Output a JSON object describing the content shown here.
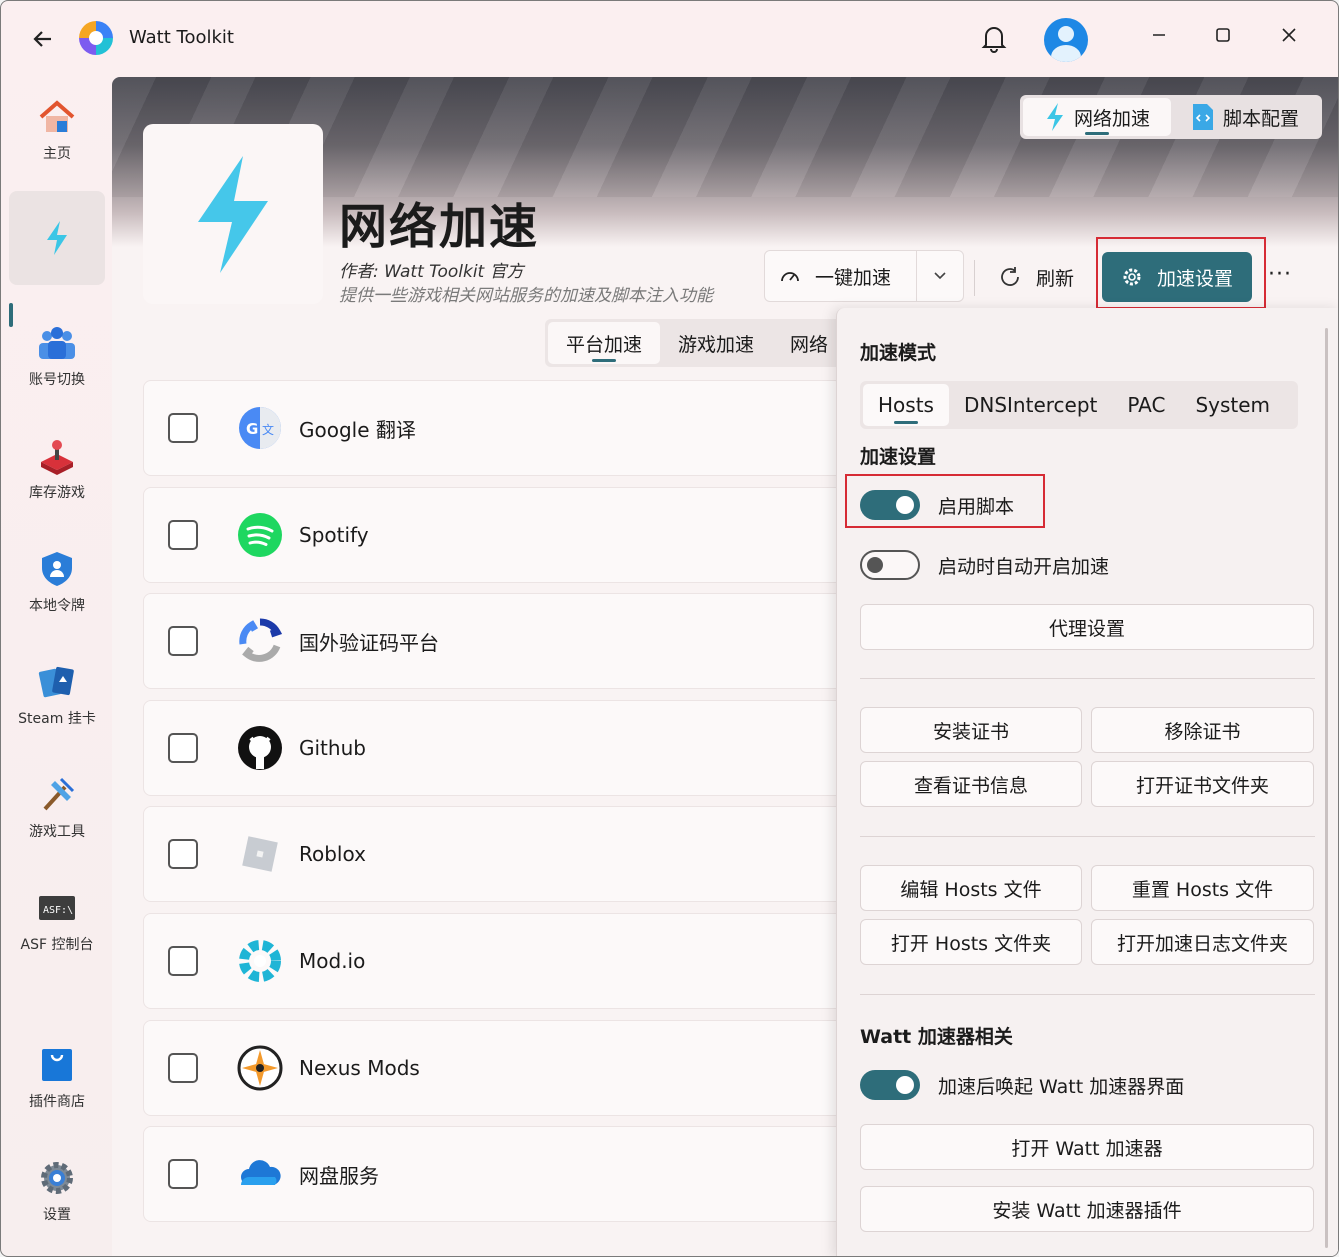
{
  "titlebar": {
    "title": "Watt Toolkit"
  },
  "sidebar": {
    "items": [
      {
        "label": "主页"
      },
      {
        "label": ""
      },
      {
        "label": "账号切换"
      },
      {
        "label": "库存游戏"
      },
      {
        "label": "本地令牌"
      },
      {
        "label": "Steam 挂卡"
      },
      {
        "label": "游戏工具"
      },
      {
        "label": "ASF 控制台"
      },
      {
        "label": "插件商店"
      },
      {
        "label": "设置"
      }
    ]
  },
  "header": {
    "tabs": [
      {
        "label": "网络加速"
      },
      {
        "label": "脚本配置"
      }
    ]
  },
  "plugin": {
    "title": "网络加速",
    "author": "作者:  Watt Toolkit  官方",
    "description": "提供一些游戏相关网站服务的加速及脚本注入功能"
  },
  "toolbar": {
    "one_click": "一键加速",
    "refresh": "刷新",
    "accel_settings": "加速设置",
    "more": "···"
  },
  "categories": [
    {
      "label": "平台加速"
    },
    {
      "label": "游戏加速"
    },
    {
      "label": "网络"
    }
  ],
  "services": [
    {
      "name": "Google 翻译"
    },
    {
      "name": "Spotify"
    },
    {
      "name": "国外验证码平台"
    },
    {
      "name": "Github"
    },
    {
      "name": "Roblox"
    },
    {
      "name": "Mod.io"
    },
    {
      "name": "Nexus Mods"
    },
    {
      "name": "网盘服务"
    }
  ],
  "panel": {
    "mode_heading": "加速模式",
    "modes": [
      {
        "label": "Hosts"
      },
      {
        "label": "DNSIntercept"
      },
      {
        "label": "PAC"
      },
      {
        "label": "System"
      }
    ],
    "settings_heading": "加速设置",
    "enable_script": "启用脚本",
    "auto_start": "启动时自动开启加速",
    "proxy_settings": "代理设置",
    "install_cert": "安装证书",
    "remove_cert": "移除证书",
    "view_cert": "查看证书信息",
    "open_cert_folder": "打开证书文件夹",
    "edit_hosts": "编辑 Hosts 文件",
    "reset_hosts": "重置 Hosts 文件",
    "open_hosts_folder": "打开 Hosts 文件夹",
    "open_log_folder": "打开加速日志文件夹",
    "watt_heading": "Watt 加速器相关",
    "wake_watt": "加速后唤起 Watt 加速器界面",
    "open_watt": "打开 Watt 加速器",
    "install_watt_plugin": "安装 Watt 加速器插件"
  },
  "colors": {
    "accent": "#2e6d7a",
    "highlight": "#d62b35"
  }
}
